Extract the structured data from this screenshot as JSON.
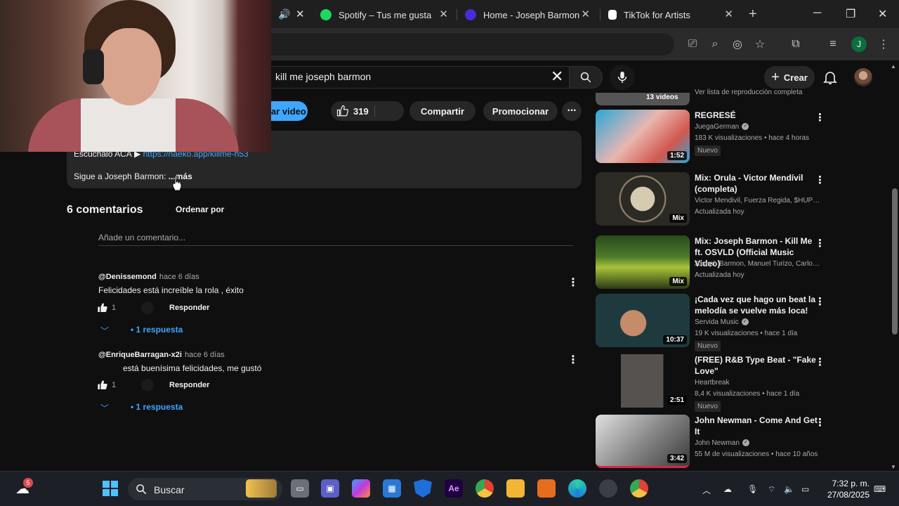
{
  "browser": {
    "tabs": [
      {
        "label": "Spotify – Tus me gusta",
        "color": "#1ed760"
      },
      {
        "label": "Home - Joseph Barmon",
        "color": "#4b2bd9"
      },
      {
        "label": "TikTok for Artists",
        "color": "#ffffff"
      }
    ],
    "new_tab": "+"
  },
  "youtube": {
    "search": {
      "query": "kill me joseph barmon"
    },
    "create_label": "Crear",
    "profile_letter": "J"
  },
  "video": {
    "save_label": "ar video",
    "likes": "319",
    "share_label": "Compartir",
    "promote_label": "Promocionar"
  },
  "description": {
    "line1_prefix": "Escúchalo ACÁ ▶",
    "line1_link": "https://naeko.app/killme-h53",
    "line2": "Sigue a Joseph Barmon:",
    "more": "...más"
  },
  "comments": {
    "count_label": "6 comentarios",
    "sort_label": "Ordenar por",
    "input_placeholder": "Añade un comentario...",
    "reply_label": "Responder",
    "items": [
      {
        "author": "@Denissemond",
        "time": "hace 6 días",
        "text": "Felicidades está increíble la rola , éxito",
        "likes": "1",
        "replies": "1 respuesta"
      },
      {
        "author": "@EnriqueBarragan-x2i",
        "time": "hace 6 días",
        "text": "está buenísima felicidades, me gustó",
        "likes": "1",
        "replies": "1 respuesta"
      }
    ]
  },
  "sidebar": {
    "top_label": "13 videos",
    "top_meta": "Ver lista de reproducción completa",
    "items": [
      {
        "title": "REGRESÉ",
        "channel": "JuegaGerman",
        "stats": "183 K visualizaciones • hace 4 horas",
        "badge": "Nuevo",
        "duration": "1:52",
        "thumb_color": "#e9b6b0"
      },
      {
        "title": "Mix: Orula - Victor Mendívil (completa)",
        "channel": "Victor Mendivil, Fuerza Regida, $HUPE y ...",
        "stats": "Actualizada hoy",
        "badge": "",
        "duration": "Mix",
        "thumb_color": "#2c2a24"
      },
      {
        "title": "Mix: Joseph Barmon - Kill Me ft. OSVLD (Official Music Video)",
        "channel": "Joseph Barmon, Manuel Turizo, Carlos V...",
        "stats": "Actualizada hoy",
        "badge": "",
        "duration": "Mix",
        "thumb_color": "#3d6a2a"
      },
      {
        "title": "¡Cada vez que hago un beat la melodía se vuelve más loca!",
        "channel": "Servida Music",
        "stats": "19 K visualizaciones • hace 1 día",
        "badge": "Nuevo",
        "duration": "10:37",
        "thumb_color": "#1f3a3f"
      },
      {
        "title": "(FREE) R&B Type Beat - \"Fake Love\"",
        "channel": "Heartbreak",
        "stats": "8,4 K visualizaciones • hace 1 día",
        "badge": "Nuevo",
        "duration": "2:51",
        "thumb_color": "#55524f"
      },
      {
        "title": "John Newman - Come And Get It",
        "channel": "John Newman",
        "stats": "55 M de visualizaciones • hace 10 años",
        "badge": "",
        "duration": "3:42",
        "thumb_color": "#9a9a9a"
      }
    ]
  },
  "taskbar": {
    "search_label": "Buscar",
    "weather_badge": "5",
    "time": "7:32 p. m.",
    "date": "27/08/2025"
  }
}
